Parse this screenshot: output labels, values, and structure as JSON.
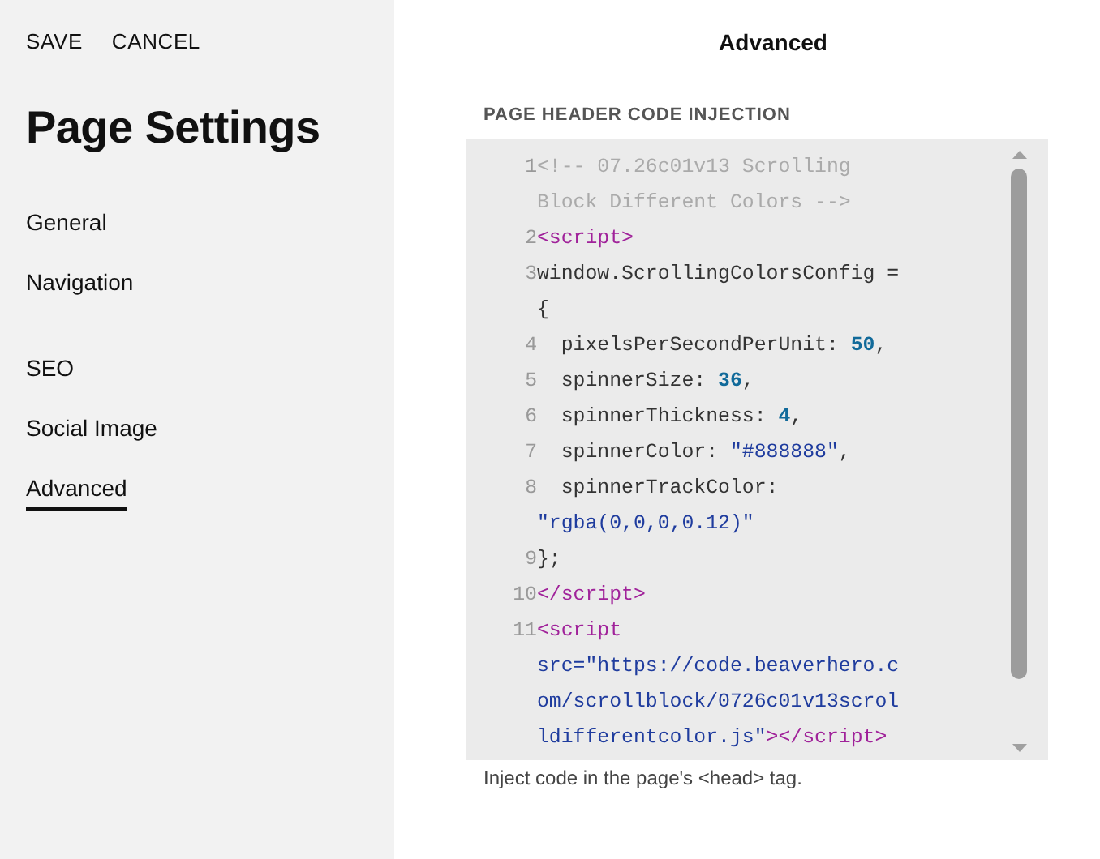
{
  "sidebar": {
    "actions": [
      "SAVE",
      "CANCEL"
    ],
    "title": "Page Settings",
    "groups": [
      [
        {
          "label": "General",
          "selected": false
        },
        {
          "label": "Navigation",
          "selected": false
        }
      ],
      [
        {
          "label": "SEO",
          "selected": false
        },
        {
          "label": "Social Image",
          "selected": false
        },
        {
          "label": "Advanced",
          "selected": true
        }
      ]
    ]
  },
  "panel": {
    "title": "Advanced",
    "field_label": "PAGE HEADER CODE INJECTION",
    "code_lines": [
      {
        "number": "1",
        "tokens": [
          {
            "kind": "comment",
            "text": "<!-- 07.26c01v13 Scrolling Block Different Colors -->"
          }
        ]
      },
      {
        "number": "2",
        "tokens": [
          {
            "kind": "tag",
            "text": "<script>"
          }
        ]
      },
      {
        "number": "3",
        "tokens": [
          {
            "kind": "plain",
            "text": "window.ScrollingColorsConfig = {"
          }
        ]
      },
      {
        "number": "4",
        "tokens": [
          {
            "kind": "plain",
            "text": "  pixelsPerSecondPerUnit: "
          },
          {
            "kind": "number",
            "text": "50"
          },
          {
            "kind": "plain",
            "text": ","
          }
        ]
      },
      {
        "number": "5",
        "tokens": [
          {
            "kind": "plain",
            "text": "  spinnerSize: "
          },
          {
            "kind": "number",
            "text": "36"
          },
          {
            "kind": "plain",
            "text": ","
          }
        ]
      },
      {
        "number": "6",
        "tokens": [
          {
            "kind": "plain",
            "text": "  spinnerThickness: "
          },
          {
            "kind": "number",
            "text": "4"
          },
          {
            "kind": "plain",
            "text": ","
          }
        ]
      },
      {
        "number": "7",
        "tokens": [
          {
            "kind": "plain",
            "text": "  spinnerColor: "
          },
          {
            "kind": "string",
            "text": "\"#888888\""
          },
          {
            "kind": "plain",
            "text": ","
          }
        ]
      },
      {
        "number": "8",
        "tokens": [
          {
            "kind": "plain",
            "text": "  spinnerTrackColor: "
          },
          {
            "kind": "string",
            "text": "\"rgba(0,0,0,0.12)\""
          }
        ]
      },
      {
        "number": "9",
        "tokens": [
          {
            "kind": "plain",
            "text": "};"
          }
        ]
      },
      {
        "number": "10",
        "tokens": [
          {
            "kind": "tag",
            "text": "</script>"
          }
        ]
      },
      {
        "number": "11",
        "tokens": [
          {
            "kind": "tag",
            "text": "<script "
          },
          {
            "kind": "string",
            "text": "src=\"https://code.beaverhero.com/scrollblock/0726c01v13scrolldifferentcolor.js\""
          },
          {
            "kind": "tag",
            "text": "></script>"
          }
        ]
      }
    ],
    "help_text": "Inject code in the page's <head> tag."
  }
}
